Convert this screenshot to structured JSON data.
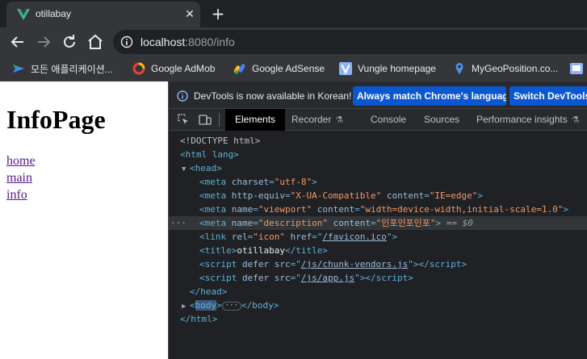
{
  "browser": {
    "tab": {
      "title": "otillabay",
      "close_glyph": "✕"
    },
    "new_tab_glyph": "+",
    "url": {
      "host": "localhost",
      "rest": ":8080/info"
    },
    "bookmarks": [
      {
        "label": "모든 애플리케이션...",
        "icon": "apps-icon"
      },
      {
        "label": "Google AdMob",
        "icon": "admob-icon"
      },
      {
        "label": "Google AdSense",
        "icon": "adsense-icon"
      },
      {
        "label": "Vungle homepage",
        "icon": "vungle-icon"
      },
      {
        "label": "MyGeoPosition.co...",
        "icon": "location-pin-icon"
      }
    ]
  },
  "page": {
    "title": "InfoPage",
    "links": [
      "home",
      "main",
      "info"
    ]
  },
  "devtools": {
    "infobar": {
      "text": "DevTools is now available in Korean!",
      "button_match": "Always match Chrome's language",
      "button_switch": "Switch DevTools to Korean"
    },
    "tabs": [
      "Elements",
      "Recorder",
      "Console",
      "Sources",
      "Performance insights"
    ],
    "active_tab": "Elements",
    "dom": {
      "doctype": "<!DOCTYPE html>",
      "html_open": "<html lang>",
      "head_open": "<head>",
      "meta_charset": {
        "tag": "meta",
        "attr": "charset",
        "value": "\"utf-8\""
      },
      "meta_http": {
        "attr1": "http-equiv",
        "val1": "\"X-UA-Compatible\"",
        "attr2": "content",
        "val2": "\"IE=edge\""
      },
      "meta_viewport": {
        "attr1": "name",
        "val1": "\"viewport\"",
        "attr2": "content",
        "val2": "\"width=device-width,initial-scale=1.0\""
      },
      "meta_description": {
        "attr1": "name",
        "val1": "\"description\"",
        "attr2": "content",
        "val2": "\"인포인포인포\"",
        "suffix": "== $0"
      },
      "link_icon": {
        "attr1": "rel",
        "val1": "\"icon\"",
        "attr2": "href",
        "val2": "/favicon.ico"
      },
      "title_text": "otillabay",
      "script1_src": "/js/chunk-vendors.js",
      "script2_src": "/js/app.js",
      "head_close": "</head>",
      "body_open": "body",
      "body_close": "</body>",
      "html_close": "</html>"
    }
  },
  "colors": {
    "accent": "#0b57d0",
    "tag": "#5db0d7",
    "attr": "#9bbbdc",
    "value": "#f29766",
    "link": "#551a8b"
  }
}
